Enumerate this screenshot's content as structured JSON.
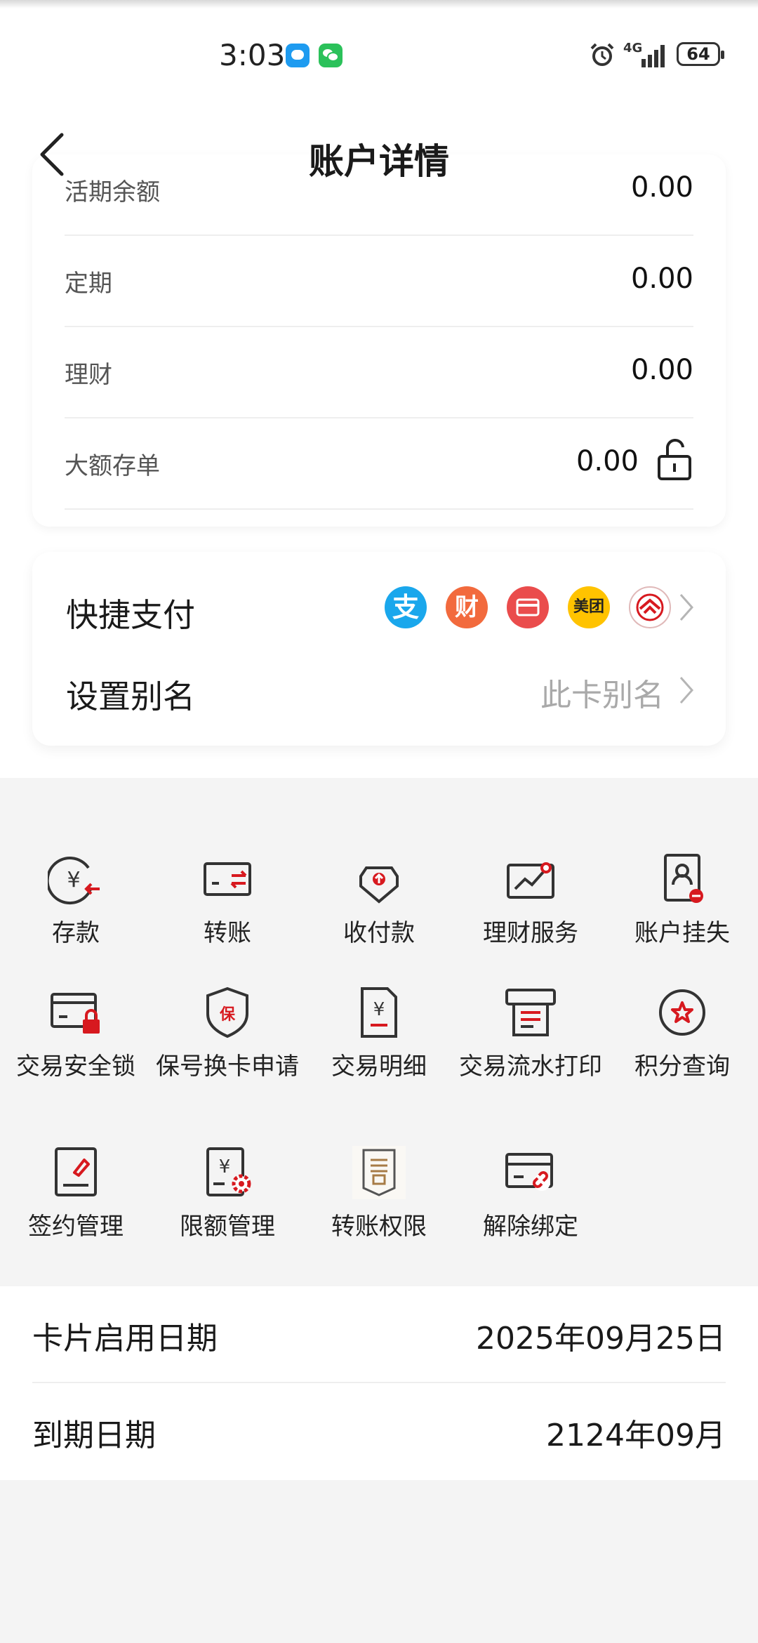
{
  "status_bar": {
    "time": "3:03",
    "network": "4G",
    "battery": "64"
  },
  "header": {
    "title": "账户详情"
  },
  "balances": [
    {
      "label": "活期余额",
      "value": "0.00"
    },
    {
      "label": "定期",
      "value": "0.00"
    },
    {
      "label": "理财",
      "value": "0.00"
    },
    {
      "label": "大额存单",
      "value": "0.00"
    }
  ],
  "quick_pay": {
    "label": "快捷支付",
    "providers": [
      "支",
      "财",
      "美团"
    ]
  },
  "alias": {
    "label": "设置别名",
    "value": "此卡别名"
  },
  "services": [
    {
      "label": "存款",
      "icon": "deposit-icon"
    },
    {
      "label": "转账",
      "icon": "transfer-icon"
    },
    {
      "label": "收付款",
      "icon": "receive-pay-icon"
    },
    {
      "label": "理财服务",
      "icon": "wealth-service-icon"
    },
    {
      "label": "账户挂失",
      "icon": "report-loss-icon"
    },
    {
      "label": "交易安全锁",
      "icon": "security-lock-icon"
    },
    {
      "label": "保号换卡申请",
      "icon": "card-replace-icon",
      "icon_text": "保"
    },
    {
      "label": "交易明细",
      "icon": "transaction-detail-icon"
    },
    {
      "label": "交易流水打印",
      "icon": "statement-print-icon"
    },
    {
      "label": "积分查询",
      "icon": "points-icon"
    },
    {
      "label": "签约管理",
      "icon": "contract-icon"
    },
    {
      "label": "限额管理",
      "icon": "limit-icon"
    },
    {
      "label": "转账权限",
      "icon": "transfer-permission-icon"
    },
    {
      "label": "解除绑定",
      "icon": "unbind-icon"
    }
  ],
  "card_info": [
    {
      "label": "卡片启用日期",
      "value": "2025年09月25日"
    },
    {
      "label": "到期日期",
      "value": "2124年09月"
    }
  ],
  "colors": {
    "accent_red": "#d7191f",
    "alipay_blue": "#1aa7ec",
    "meituan_yellow": "#ffc300"
  }
}
